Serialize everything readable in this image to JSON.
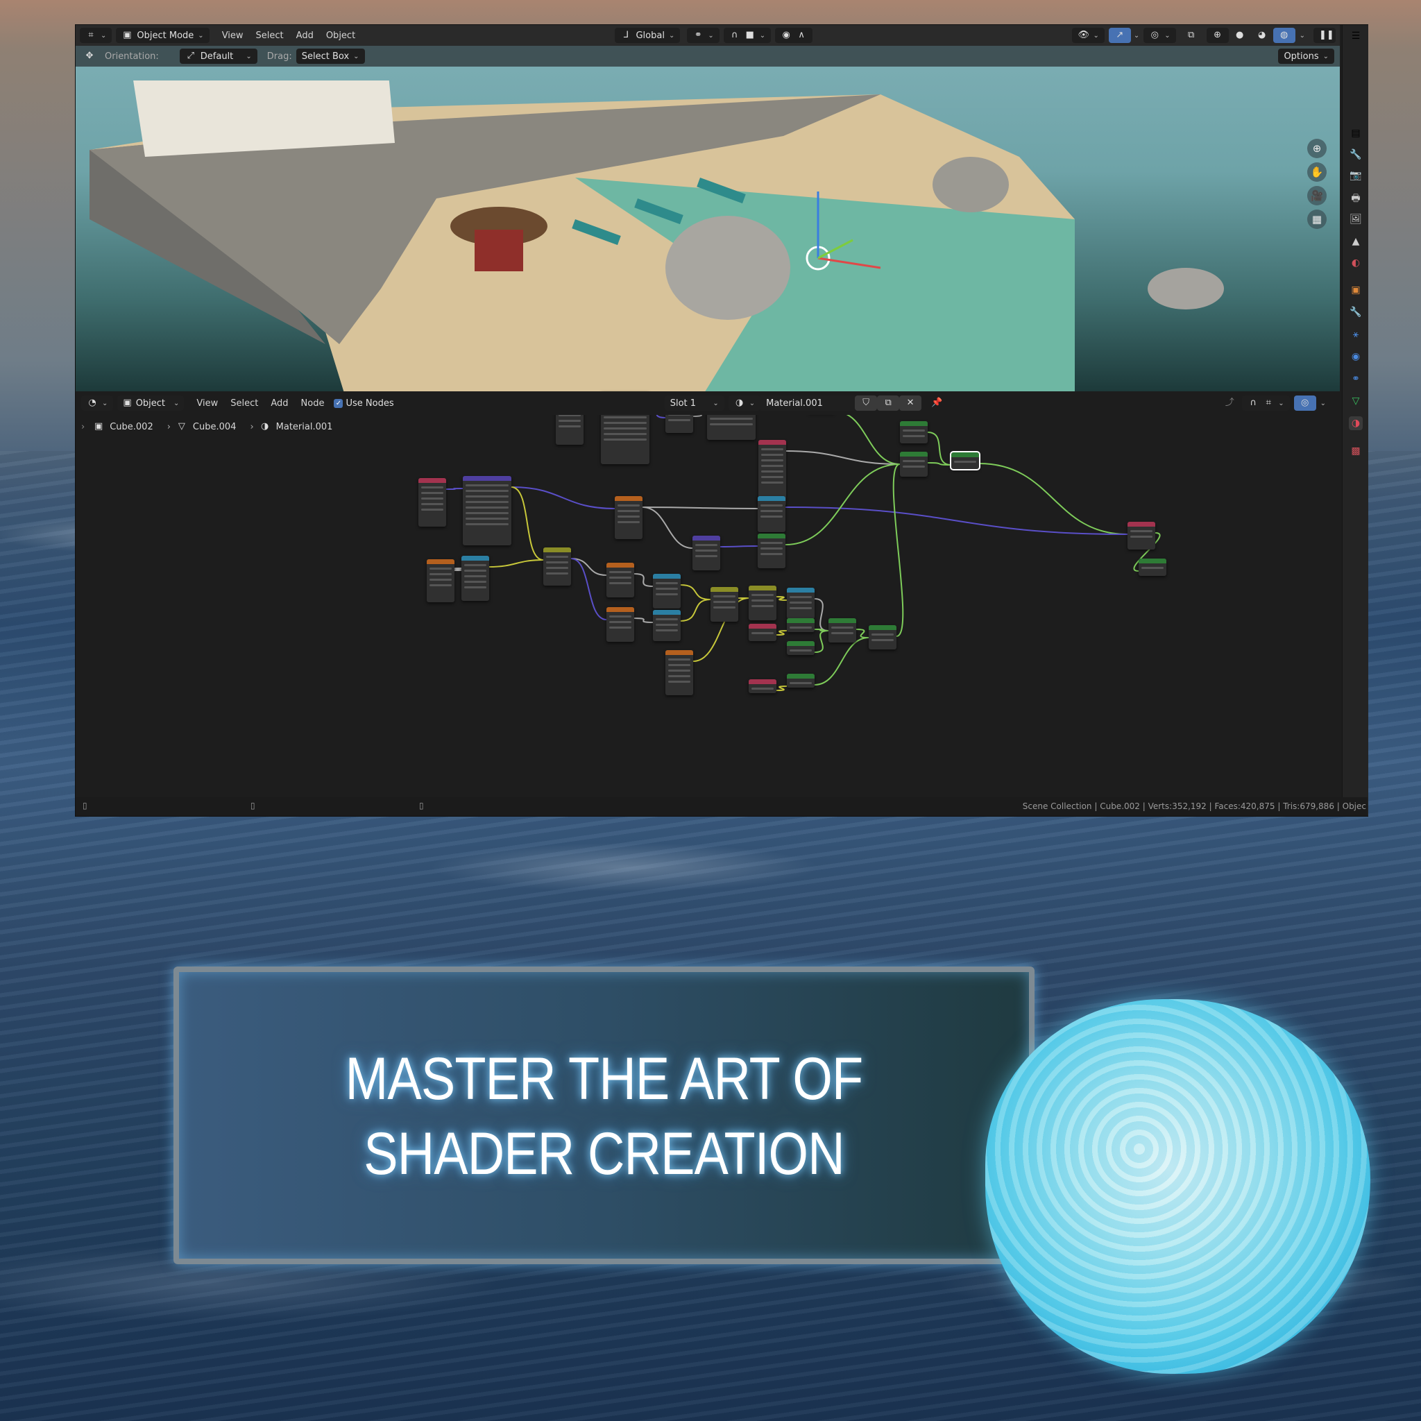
{
  "topbar": {
    "editor_type_icon": "3d-viewport-icon",
    "mode": "Object Mode",
    "menus": [
      "View",
      "Select",
      "Add",
      "Object"
    ],
    "transform_orientation": "Global",
    "options_label": "Options"
  },
  "tool_settings": {
    "orientation_label": "Orientation:",
    "orientation_value": "Default",
    "drag_label": "Drag:",
    "drag_value": "Select Box"
  },
  "gizmo_axes": [
    "Z",
    "Y",
    "X"
  ],
  "node_editor": {
    "editor_type_icon": "shader-editor-icon",
    "mode": "Object",
    "menus": [
      "View",
      "Select",
      "Add",
      "Node"
    ],
    "use_nodes_label": "Use Nodes",
    "use_nodes_checked": true,
    "slot": "Slot 1",
    "material": "Material.001",
    "breadcrumb": [
      "Cube.002",
      "Cube.004",
      "Material.001"
    ]
  },
  "status_bar": {
    "text": "Scene Collection | Cube.002 | Verts:352,192 | Faces:420,875 | Tris:679,886 | Objec"
  },
  "properties_tabs": [
    "tool",
    "render",
    "output",
    "view-layer",
    "scene",
    "world",
    "object",
    "modifiers",
    "particles",
    "physics",
    "constraints",
    "data",
    "material",
    "texture"
  ],
  "colors": {
    "accent_blue": "#4772b3",
    "node_input": "#a3334f",
    "node_vector": "#4f3fa0",
    "node_texture": "#b5601e",
    "node_converter": "#2b7fa3",
    "node_shader": "#2e7b36",
    "node_color": "#8a8d26"
  },
  "banner": {
    "line1": "MASTER THE ART OF",
    "line2": "SHADER CREATION"
  }
}
